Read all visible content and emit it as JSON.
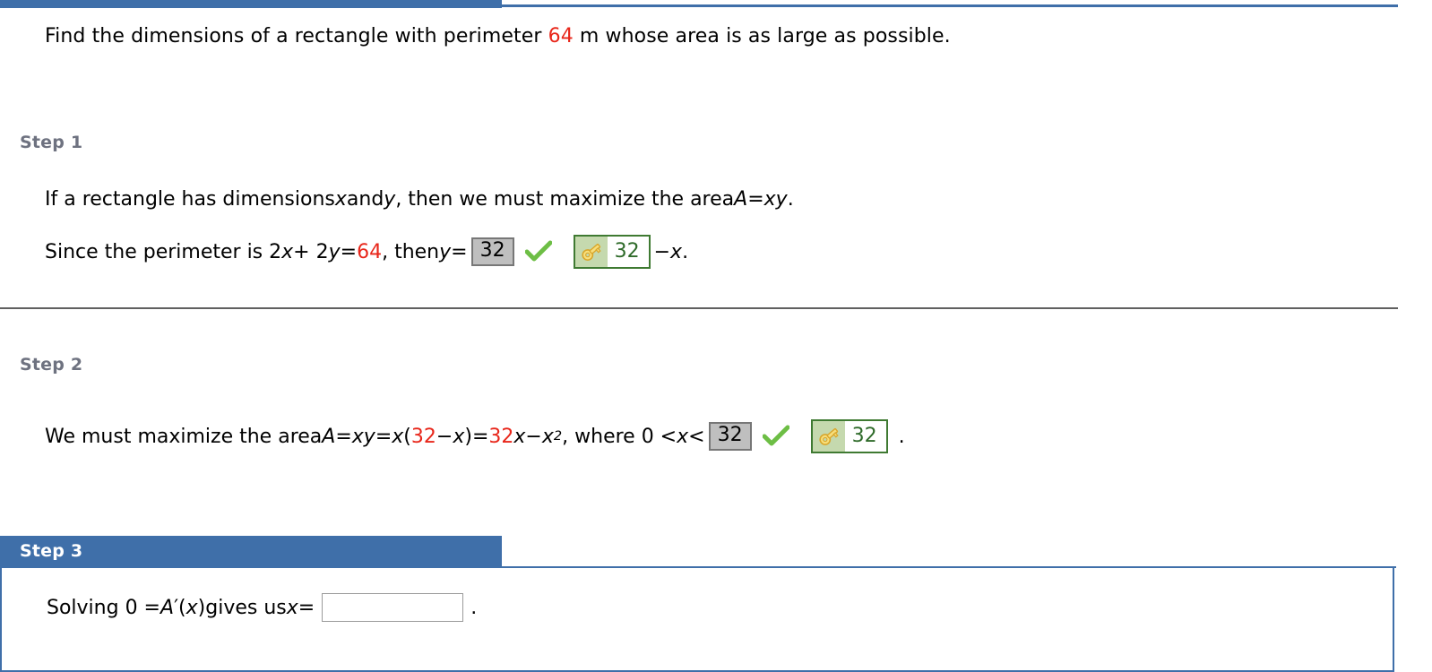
{
  "colors": {
    "accent_blue": "#3F6FA9",
    "red_value": "#E8261A",
    "step_label_gray": "#6E7280",
    "answer_gray_fill": "#BFBFBF",
    "answer_gray_border": "#777777",
    "key_green_border": "#3F7A32",
    "key_green_fill": "#C5D9AE",
    "key_text_green": "#2F6B2A",
    "check_green": "#6DBE45"
  },
  "problem": {
    "part1": "Find the dimensions of a rectangle with perimeter ",
    "value": "64",
    "part2": " m whose area is as large as possible."
  },
  "steps": [
    {
      "label": "Step 1",
      "lines": [
        {
          "segments": [
            {
              "text": "If a rectangle has dimensions "
            },
            {
              "text": "x",
              "style": "italic"
            },
            {
              "text": " and "
            },
            {
              "text": "y",
              "style": "italic"
            },
            {
              "text": ", then we must maximize the area  "
            },
            {
              "text": "A",
              "style": "italic"
            },
            {
              "text": " = "
            },
            {
              "text": "xy",
              "style": "italic"
            },
            {
              "text": "."
            }
          ]
        }
      ],
      "answer_line": {
        "prefix_a": "Since the perimeter is  2",
        "prefix_x": "x",
        "prefix_b": " + 2",
        "prefix_y": "y",
        "prefix_c": " = ",
        "perimeter": "64",
        "prefix_d": ",  then  ",
        "var_y": "y",
        "equals": " = ",
        "graded_value": "32",
        "check_icon": "green-check-icon",
        "key_icon": "key-icon",
        "key_value": "32",
        "suffix_dash": " − ",
        "suffix_x": "x",
        "suffix_period": "."
      }
    },
    {
      "label": "Step 2",
      "answer_line": {
        "prefix": "We must maximize the area  ",
        "A": "A",
        "eq1": " = ",
        "xy": "xy",
        "eq2": " = ",
        "x1": "x",
        "paren_open": "(",
        "red1": "32",
        "minus1": " − ",
        "x2": "x",
        "paren_close": ")",
        "eq3": " = ",
        "red2": "32",
        "x3": "x",
        "minus2": " − ",
        "x4": "x",
        "exp": "2",
        "comma": ",  where  0 < ",
        "x5": "x",
        "lt": " < ",
        "graded_value": "32",
        "check_icon": "green-check-icon",
        "key_icon": "key-icon",
        "key_value": "32",
        "period": "."
      }
    },
    {
      "label": "Step 3",
      "answer_line": {
        "prefix": "Solving  0 = ",
        "A": "A",
        "prime": "′(",
        "x": "x",
        "close": ")",
        "mid": "  gives us ",
        "var_x": "x",
        "equals": " = ",
        "input_value": "",
        "input_placeholder": "",
        "period": "."
      }
    }
  ]
}
